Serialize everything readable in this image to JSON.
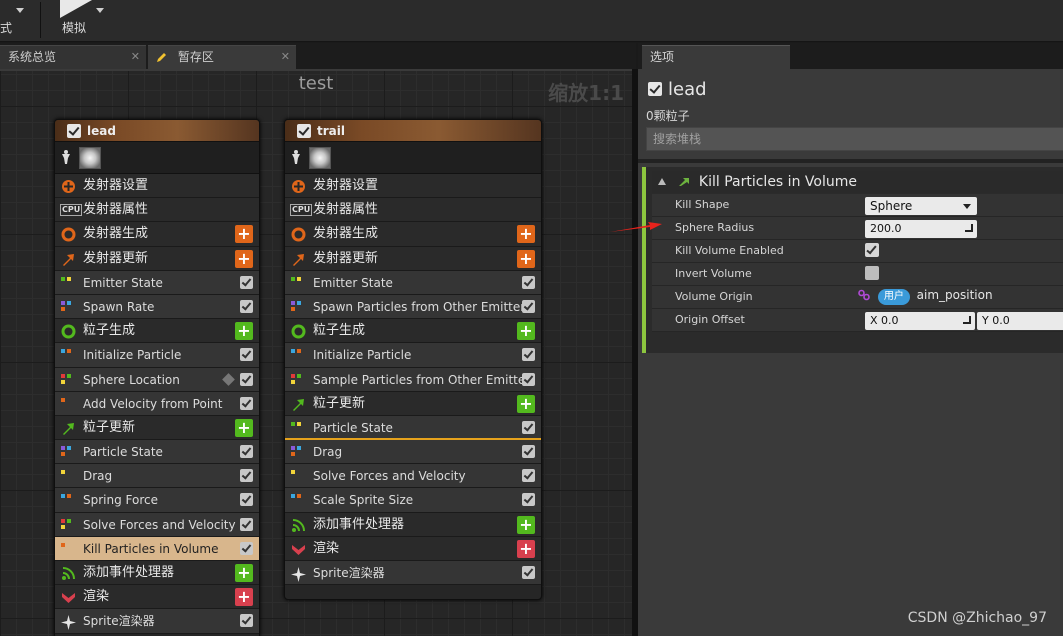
{
  "toolbar": {
    "left_label": "式",
    "simulate_label": "模拟"
  },
  "tabs": [
    {
      "label": "系统总览"
    },
    {
      "label": "暂存区"
    }
  ],
  "graph": {
    "title": "test",
    "zoom": "缩放1:1"
  },
  "emitters": [
    {
      "name": "lead",
      "rows": [
        {
          "label": "发射器设置",
          "kind": "stage",
          "icon": "emitter-settings-icon"
        },
        {
          "label": "发射器属性",
          "kind": "stage",
          "icon": "cpu-icon"
        },
        {
          "label": "发射器生成",
          "kind": "stage",
          "icon": "spawn-ring-icon",
          "add": "orange"
        },
        {
          "label": "发射器更新",
          "kind": "stage",
          "icon": "update-arrow-icon",
          "add": "orange"
        },
        {
          "label": "Emitter State",
          "kind": "mod"
        },
        {
          "label": "Spawn Rate",
          "kind": "mod"
        },
        {
          "label": "粒子生成",
          "kind": "stage",
          "icon": "particle-spawn-icon",
          "add": "green"
        },
        {
          "label": "Initialize Particle",
          "kind": "mod"
        },
        {
          "label": "Sphere Location",
          "kind": "mod",
          "cube": true
        },
        {
          "label": "Add Velocity from Point",
          "kind": "mod"
        },
        {
          "label": "粒子更新",
          "kind": "stage",
          "icon": "particle-update-icon",
          "add": "green"
        },
        {
          "label": "Particle State",
          "kind": "mod"
        },
        {
          "label": "Drag",
          "kind": "mod"
        },
        {
          "label": "Spring Force",
          "kind": "mod"
        },
        {
          "label": "Solve Forces and Velocity",
          "kind": "mod"
        },
        {
          "label": "Kill Particles in Volume",
          "kind": "sel"
        },
        {
          "label": "添加事件处理器",
          "kind": "stage",
          "icon": "event-handler-icon",
          "add": "green"
        },
        {
          "label": "渲染",
          "kind": "stage",
          "icon": "render-icon",
          "add": "red"
        },
        {
          "label": "Sprite渲染器",
          "kind": "mod",
          "icon": "sprite-icon"
        }
      ]
    },
    {
      "name": "trail",
      "rows": [
        {
          "label": "发射器设置",
          "kind": "stage",
          "icon": "emitter-settings-icon"
        },
        {
          "label": "发射器属性",
          "kind": "stage",
          "icon": "cpu-icon"
        },
        {
          "label": "发射器生成",
          "kind": "stage",
          "icon": "spawn-ring-icon",
          "add": "orange"
        },
        {
          "label": "发射器更新",
          "kind": "stage",
          "icon": "update-arrow-icon",
          "add": "orange"
        },
        {
          "label": "Emitter State",
          "kind": "mod"
        },
        {
          "label": "Spawn Particles from Other Emitter",
          "kind": "mod"
        },
        {
          "label": "粒子生成",
          "kind": "stage",
          "icon": "particle-spawn-icon",
          "add": "green"
        },
        {
          "label": "Initialize Particle",
          "kind": "mod"
        },
        {
          "label": "Sample Particles from Other Emitter",
          "kind": "mod"
        },
        {
          "label": "粒子更新",
          "kind": "stage",
          "icon": "particle-update-icon",
          "add": "green"
        },
        {
          "label": "Particle State",
          "kind": "mod",
          "highlight": true
        },
        {
          "label": "Drag",
          "kind": "mod"
        },
        {
          "label": "Solve Forces and Velocity",
          "kind": "mod"
        },
        {
          "label": "Scale Sprite Size",
          "kind": "mod"
        },
        {
          "label": "添加事件处理器",
          "kind": "stage",
          "icon": "event-handler-icon",
          "add": "green"
        },
        {
          "label": "渲染",
          "kind": "stage",
          "icon": "render-icon",
          "add": "red"
        },
        {
          "label": "Sprite渲染器",
          "kind": "mod",
          "icon": "sprite-icon"
        }
      ]
    }
  ],
  "panel": {
    "tab": "选项",
    "title": "lead",
    "count": "0颗粒子",
    "search_placeholder": "搜索堆栈",
    "module_title": "Kill Particles in Volume",
    "props": {
      "kill_shape_label": "Kill Shape",
      "kill_shape_value": "Sphere",
      "sphere_radius_label": "Sphere Radius",
      "sphere_radius_value": "200.0",
      "kill_volume_label": "Kill Volume Enabled",
      "invert_label": "Invert Volume",
      "origin_label": "Volume Origin",
      "origin_badge": "用户",
      "origin_value": "aim_position",
      "offset_label": "Origin Offset",
      "offset_x": "X  0.0",
      "offset_y": "Y  0.0"
    }
  },
  "watermark": "CSDN @Zhichao_97"
}
